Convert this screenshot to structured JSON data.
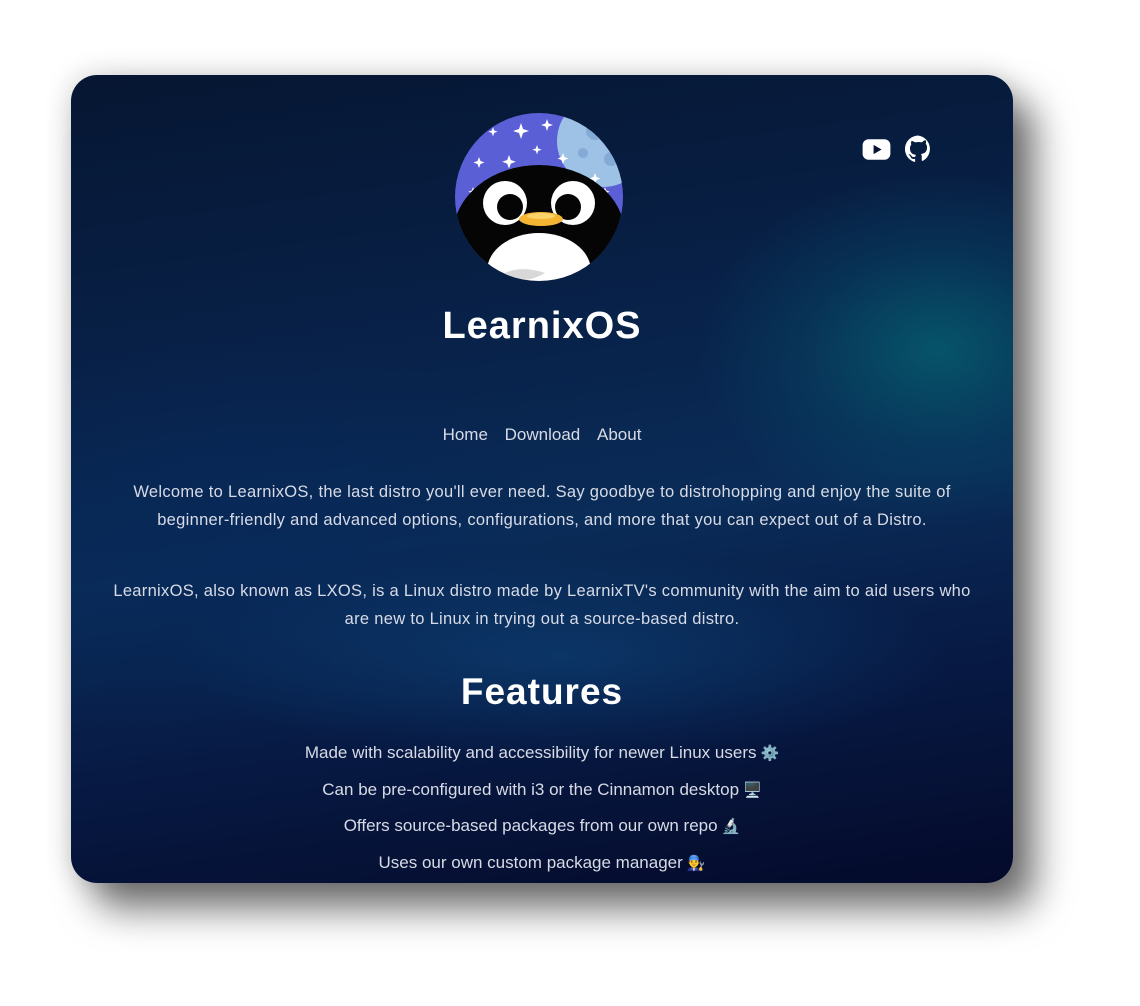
{
  "site": {
    "title": "LearnixOS"
  },
  "social": {
    "youtube_icon": "youtube-icon",
    "github_icon": "github-icon"
  },
  "nav": {
    "items": [
      {
        "label": "Home"
      },
      {
        "label": "Download"
      },
      {
        "label": "About"
      }
    ]
  },
  "intro": {
    "paragraph1": "Welcome to LearnixOS, the last distro you'll ever need. Say goodbye to distrohopping and enjoy the suite of beginner-friendly and advanced options, configurations, and more that you can expect out of a Distro.",
    "paragraph2": "LearnixOS, also known as LXOS, is a Linux distro made by LearnixTV's community with the aim to aid users who are new to Linux in trying out a source-based distro."
  },
  "features": {
    "heading": "Features",
    "items": [
      {
        "text": "Made with scalability and accessibility for newer Linux users",
        "emoji": "⚙️"
      },
      {
        "text": "Can be pre-configured with i3 or the Cinnamon desktop",
        "emoji": "🖥️"
      },
      {
        "text": "Offers source-based packages from our own repo",
        "emoji": "🔬"
      },
      {
        "text": "Uses our own custom package manager",
        "emoji": "👨‍🔧"
      }
    ]
  },
  "colors": {
    "text": "#d7dbe6",
    "heading": "#ffffff",
    "background_dark": "#040a2a",
    "background_teal": "#065c6e",
    "avatar_sky": "#5b5fd6"
  }
}
